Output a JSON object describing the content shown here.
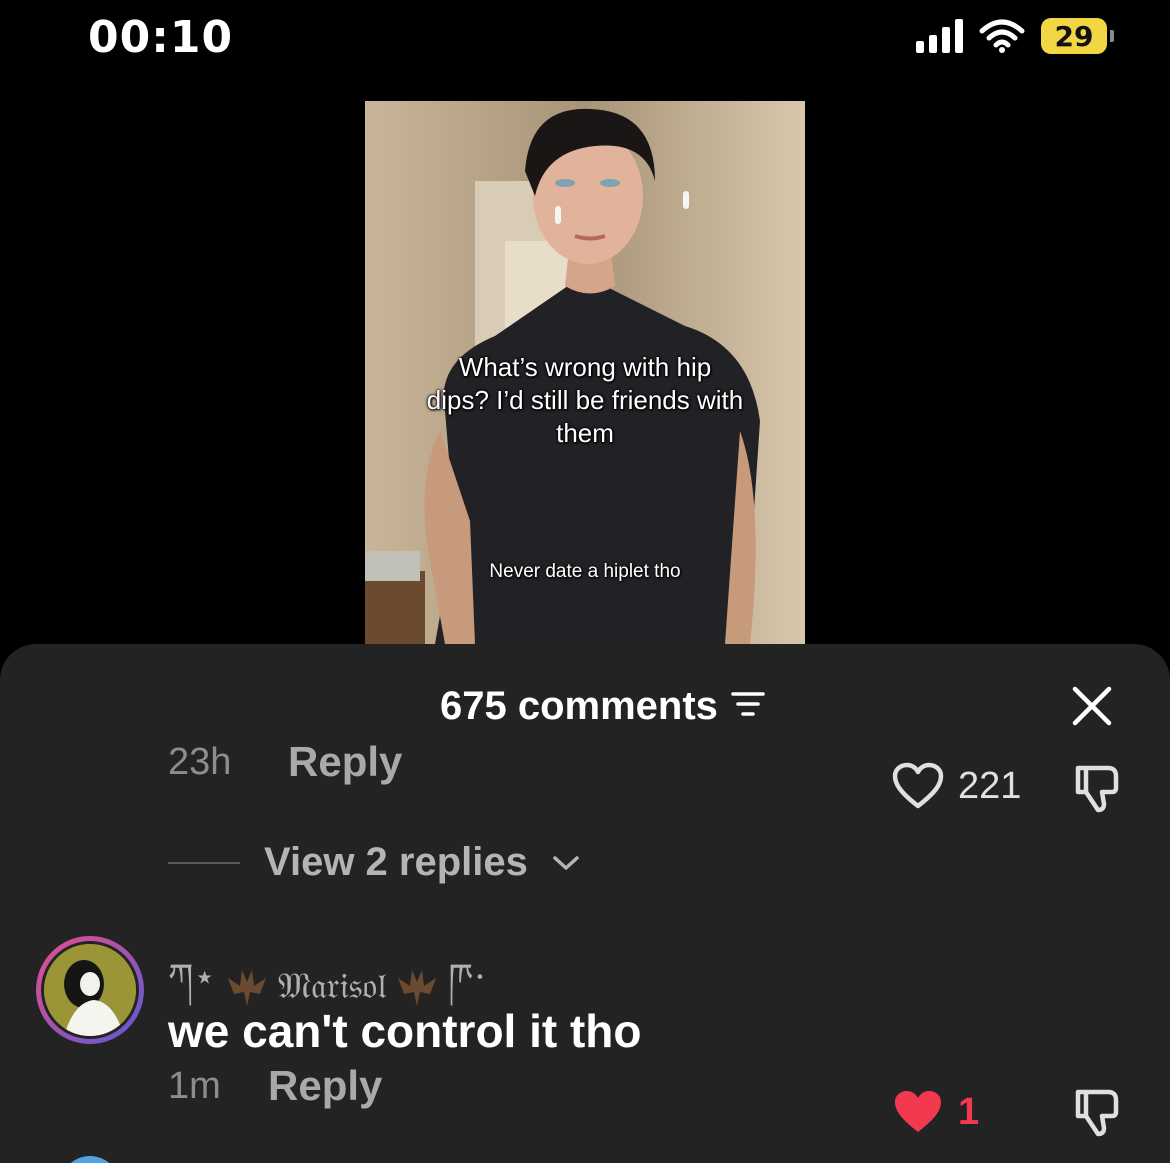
{
  "status_bar": {
    "time": "00:10",
    "battery": "29"
  },
  "video": {
    "caption_main": "What’s wrong with hip dips? I’d still be friends with them",
    "caption_sub": "Never date a hiplet tho"
  },
  "comments": {
    "title": "675 comments",
    "first": {
      "time": "23h",
      "reply": "Reply",
      "likes": "221",
      "view_replies": "View 2 replies"
    },
    "second": {
      "prefix": "ཀ⋆",
      "name": "𝔐𝔞𝔯𝔦𝔰𝔬𝔩",
      "suffix": "ཫ⋅",
      "text": "we can't control it tho",
      "time": "1m",
      "reply": "Reply",
      "likes": "1"
    }
  },
  "colors": {
    "liked_heart": "#f2394e",
    "battery": "#f2d643",
    "sheet_bg": "#232323"
  },
  "icons": [
    "signal-icon",
    "wifi-icon",
    "battery-icon",
    "filter-icon",
    "close-icon",
    "heart-icon",
    "dislike-icon",
    "chevron-down-icon",
    "bat-icon"
  ]
}
